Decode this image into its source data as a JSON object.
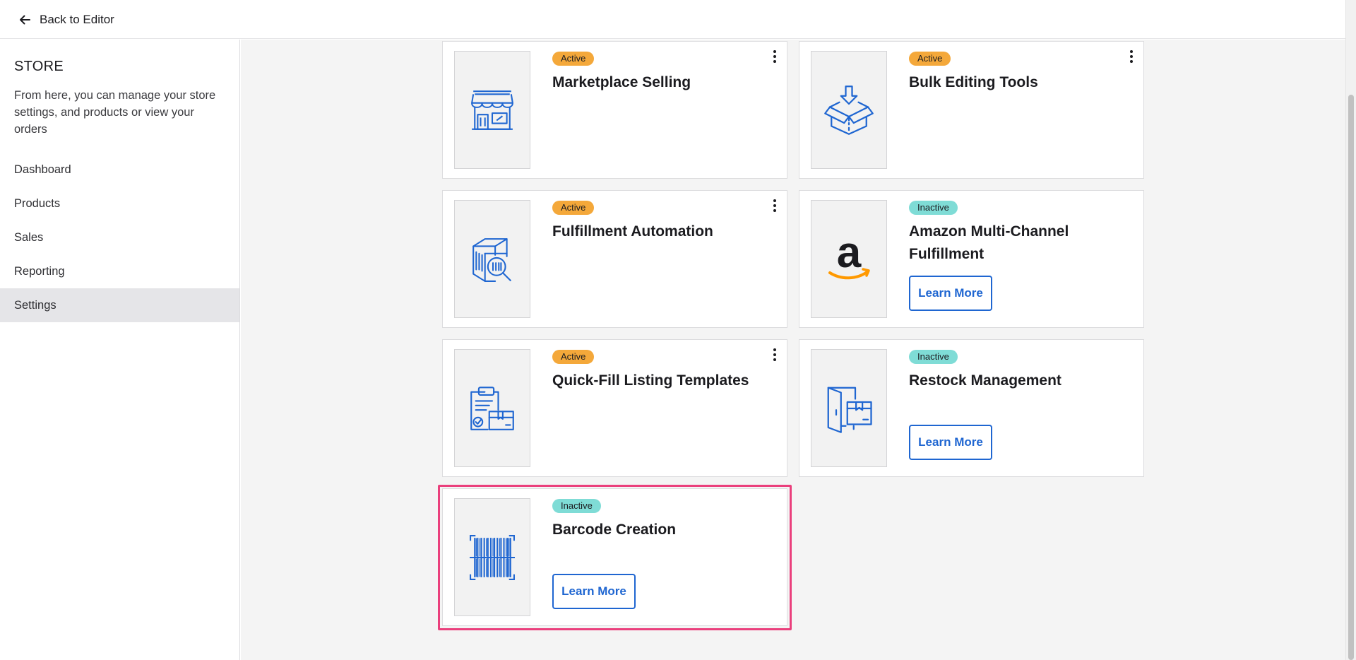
{
  "topbar": {
    "back_label": "Back to Editor"
  },
  "sidebar": {
    "title": "STORE",
    "description": "From here, you can manage your store settings, and products or view your orders",
    "items": [
      {
        "label": "Dashboard",
        "active": false
      },
      {
        "label": "Products",
        "active": false
      },
      {
        "label": "Sales",
        "active": false
      },
      {
        "label": "Reporting",
        "active": false
      },
      {
        "label": "Settings",
        "active": true
      }
    ]
  },
  "apps": [
    {
      "status": "Active",
      "title": "Marketplace Selling",
      "icon": "storefront-icon"
    },
    {
      "status": "Active",
      "title": "Bulk Editing Tools",
      "icon": "box-download-icon"
    },
    {
      "status": "Active",
      "title": "Fulfillment Automation",
      "icon": "package-search-icon"
    },
    {
      "status": "Inactive",
      "title": "Amazon Multi-Channel Fulfillment",
      "icon": "amazon-logo-icon",
      "button": "Learn More"
    },
    {
      "status": "Active",
      "title": "Quick-Fill Listing Templates",
      "icon": "clipboard-box-icon"
    },
    {
      "status": "Inactive",
      "title": "Restock Management",
      "icon": "door-box-icon",
      "button": "Learn More"
    },
    {
      "status": "Inactive",
      "title": "Barcode Creation",
      "icon": "barcode-icon",
      "button": "Learn More",
      "highlighted": true
    }
  ],
  "colors": {
    "active_badge": "#f4a83a",
    "inactive_badge": "#7fdcd6",
    "accent": "#1f66d1",
    "icon_blue": "#1f66d1",
    "highlight": "#ea3f7c"
  }
}
